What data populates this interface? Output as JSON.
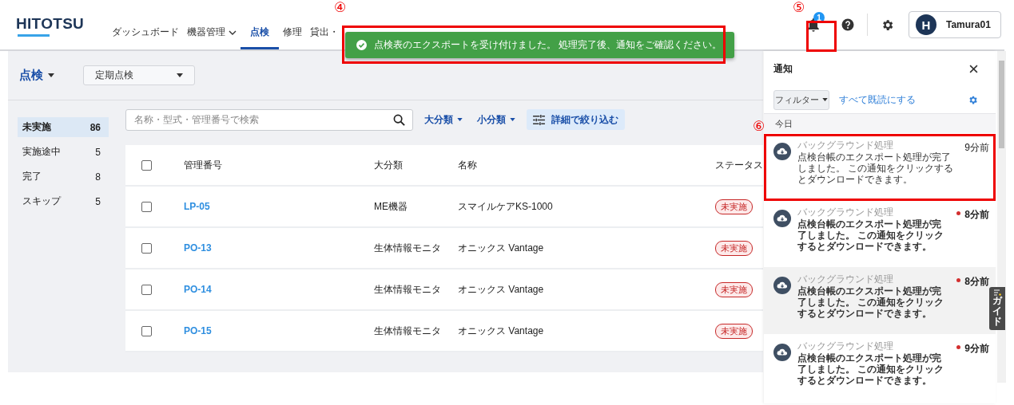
{
  "header": {
    "logo": "HITOTSU",
    "nav": [
      {
        "label": "ダッシュボード",
        "selected": false,
        "dropdown": false
      },
      {
        "label": "機器管理",
        "selected": false,
        "dropdown": true
      },
      {
        "label": "点検",
        "selected": true,
        "dropdown": false
      },
      {
        "label": "修理",
        "selected": false,
        "dropdown": false
      },
      {
        "label": "貸出・",
        "selected": false,
        "dropdown": false
      }
    ],
    "notification_badge": "1",
    "user": {
      "avatar": "H",
      "name": "Tamura01"
    }
  },
  "toast": {
    "message": "点検表のエクスポートを受け付けました。 処理完了後、通知をご確認ください。"
  },
  "page": {
    "title": "点検",
    "type_select": "定期点検"
  },
  "status_filters": [
    {
      "label": "未実施",
      "count": "86",
      "selected": true
    },
    {
      "label": "実施途中",
      "count": "5",
      "selected": false
    },
    {
      "label": "完了",
      "count": "8",
      "selected": false
    },
    {
      "label": "スキップ",
      "count": "5",
      "selected": false
    }
  ],
  "search": {
    "placeholder": "名称・型式・管理番号で検索"
  },
  "filters": [
    "大分類",
    "小分類"
  ],
  "detail_filter": "詳細で絞り込む",
  "table": {
    "select_all_checked": false,
    "columns": [
      "管理番号",
      "大分類",
      "名称",
      "ステータス"
    ],
    "rows": [
      {
        "id": "LP-05",
        "category": "ME機器",
        "name": "スマイルケアKS-1000",
        "status": "未実施",
        "checked": false
      },
      {
        "id": "PO-13",
        "category": "生体情報モニタ",
        "name": "オニックス Vantage",
        "status": "未実施",
        "checked": false
      },
      {
        "id": "PO-14",
        "category": "生体情報モニタ",
        "name": "オニックス Vantage",
        "status": "未実施",
        "checked": false
      },
      {
        "id": "PO-15",
        "category": "生体情報モニタ",
        "name": "オニックス Vantage",
        "status": "未実施",
        "checked": false
      }
    ]
  },
  "notifications": {
    "title": "通知",
    "filter": "フィルター",
    "mark_all_read": "すべて既読にする",
    "section": "今日",
    "items": [
      {
        "title": "バックグラウンド処理",
        "message": "点検台帳のエクスポート処理が完了しました。 この通知をクリックするとダウンロードできます。",
        "time": "9分前",
        "unread": false,
        "highlighted": false
      },
      {
        "title": "バックグラウンド処理",
        "message": "点検台帳のエクスポート処理が完了しました。 この通知をクリックするとダウンロードできます。",
        "time": "8分前",
        "unread": true,
        "highlighted": false
      },
      {
        "title": "バックグラウンド処理",
        "message": "点検台帳のエクスポート処理が完了しました。 この通知をクリックするとダウンロードできます。",
        "time": "8分前",
        "unread": true,
        "highlighted": true
      },
      {
        "title": "バックグラウンド処理",
        "message": "点検台帳のエクスポート処理が完了しました。 この通知をクリックするとダウンロードできます。",
        "time": "9分前",
        "unread": true,
        "highlighted": false
      }
    ]
  },
  "guide_tab": "ガイド",
  "annotations": [
    {
      "label": "④"
    },
    {
      "label": "⑤"
    },
    {
      "label": "⑥"
    }
  ]
}
